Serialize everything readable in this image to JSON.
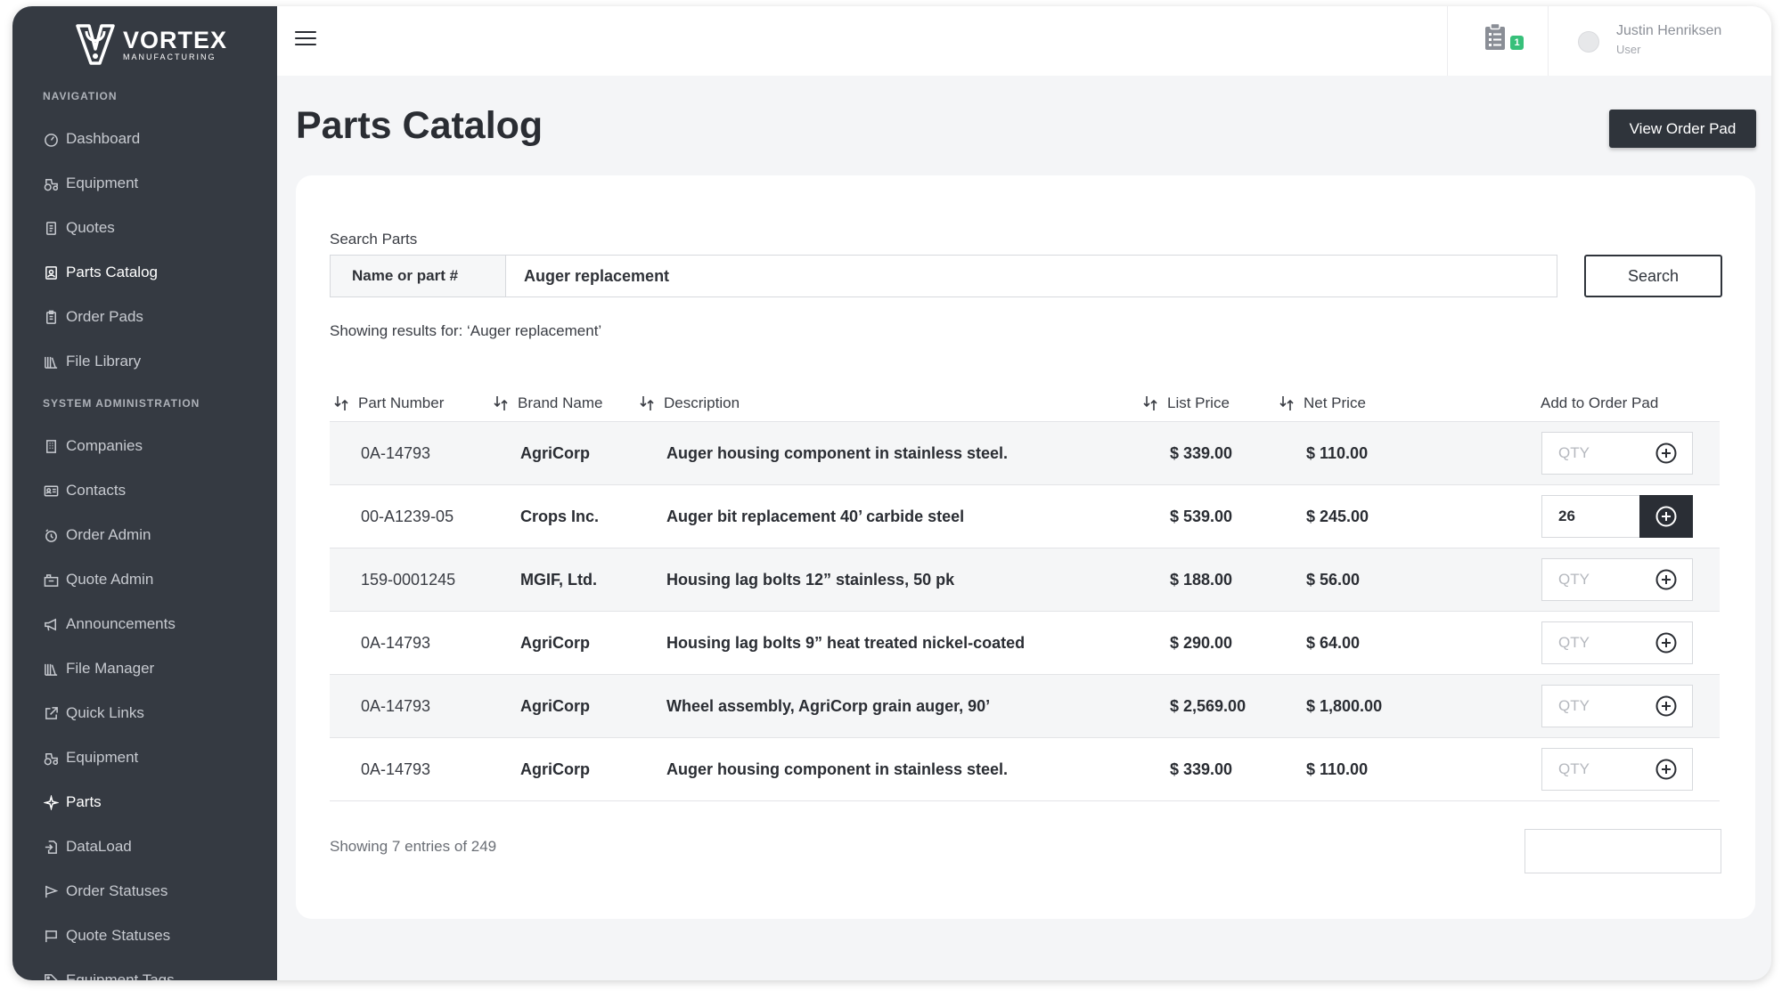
{
  "brand": {
    "name": "VORTEX",
    "tagline": "MANUFACTURING"
  },
  "sidebar": {
    "navigation_heading": "NAVIGATION",
    "navigation": [
      {
        "label": "Dashboard",
        "icon": "dashboard-gauge-icon"
      },
      {
        "label": "Equipment",
        "icon": "tractor-icon"
      },
      {
        "label": "Quotes",
        "icon": "document-icon"
      },
      {
        "label": "Parts Catalog",
        "icon": "catalog-icon",
        "active": true
      },
      {
        "label": "Order Pads",
        "icon": "clipboard-icon"
      },
      {
        "label": "File Library",
        "icon": "library-icon"
      }
    ],
    "admin_heading": "SYSTEM ADMINISTRATION",
    "admin": [
      {
        "label": "Companies",
        "icon": "building-icon"
      },
      {
        "label": "Contacts",
        "icon": "contact-card-icon"
      },
      {
        "label": "Order Admin",
        "icon": "order-admin-icon"
      },
      {
        "label": "Quote Admin",
        "icon": "quote-admin-icon"
      },
      {
        "label": "Announcements",
        "icon": "megaphone-icon"
      },
      {
        "label": "File Manager",
        "icon": "library-icon"
      },
      {
        "label": "Quick Links",
        "icon": "external-link-icon"
      },
      {
        "label": "Equipment",
        "icon": "tractor-icon"
      },
      {
        "label": "Parts",
        "icon": "sparkle-icon"
      },
      {
        "label": "DataLoad",
        "icon": "file-import-icon"
      },
      {
        "label": "Order Statuses",
        "icon": "flag-icon"
      },
      {
        "label": "Quote Statuses",
        "icon": "flag-icon"
      },
      {
        "label": "Equipment Tags",
        "icon": "tag-icon"
      }
    ]
  },
  "topbar": {
    "order_pad_badge": "1",
    "user": {
      "name": "Justin Henriksen",
      "role": "User"
    }
  },
  "page": {
    "title": "Parts Catalog",
    "view_order_pad_label": "View Order Pad"
  },
  "search": {
    "label": "Search Parts",
    "prefix": "Name or part #",
    "value": "Auger replacement",
    "button_label": "Search",
    "results_text": "Showing results for: ‘Auger replacement’"
  },
  "table": {
    "columns": {
      "part_number": "Part Number",
      "brand": "Brand Name",
      "description": "Description",
      "list_price": "List Price",
      "net_price": "Net Price",
      "add": "Add to Order Pad"
    },
    "qty_placeholder": "QTY",
    "rows": [
      {
        "part_number": "0A-14793",
        "brand": "AgriCorp",
        "description": "Auger housing component in stainless steel.",
        "list_price": "$ 339.00",
        "net_price": "$ 110.00",
        "qty": ""
      },
      {
        "part_number": "00-A1239-05",
        "brand": "Crops Inc.",
        "description": "Auger bit replacement 40’ carbide steel",
        "list_price": "$ 539.00",
        "net_price": "$ 245.00",
        "qty": "26"
      },
      {
        "part_number": "159-0001245",
        "brand": "MGIF, Ltd.",
        "description": "Housing lag bolts 12” stainless, 50 pk",
        "list_price": "$ 188.00",
        "net_price": "$ 56.00",
        "qty": ""
      },
      {
        "part_number": "0A-14793",
        "brand": "AgriCorp",
        "description": "Housing lag bolts 9” heat treated nickel-coated",
        "list_price": "$ 290.00",
        "net_price": "$ 64.00",
        "qty": ""
      },
      {
        "part_number": "0A-14793",
        "brand": "AgriCorp",
        "description": "Wheel assembly, AgriCorp grain auger, 90’",
        "list_price": "$ 2,569.00",
        "net_price": "$ 1,800.00",
        "qty": ""
      },
      {
        "part_number": "0A-14793",
        "brand": "AgriCorp",
        "description": "Auger housing component in stainless steel.",
        "list_price": "$ 339.00",
        "net_price": "$ 110.00",
        "qty": ""
      }
    ]
  },
  "footer": {
    "entries_text": "Showing 7 entries of 249"
  },
  "colors": {
    "sidebar": "#353a42",
    "accent_dark": "#2f343b",
    "badge": "#37c07a"
  }
}
